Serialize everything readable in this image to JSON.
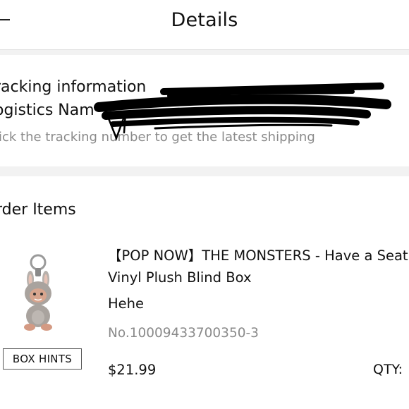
{
  "header": {
    "title": "Details"
  },
  "tracking": {
    "title": "racking information",
    "logistics_label": "ogistics Nam",
    "hint": "lick the tracking number to get the latest shipping"
  },
  "order": {
    "section_title": "rder Items",
    "item": {
      "name": "【POP NOW】THE MONSTERS - Have a Seat Vinyl Plush Blind Box",
      "variant": "Hehe",
      "number": "No.10009433700350-3",
      "price": "$21.99",
      "qty_label": "QTY:",
      "hints_button": "BOX HINTS",
      "image_icon": "plush-keychain-image"
    }
  }
}
